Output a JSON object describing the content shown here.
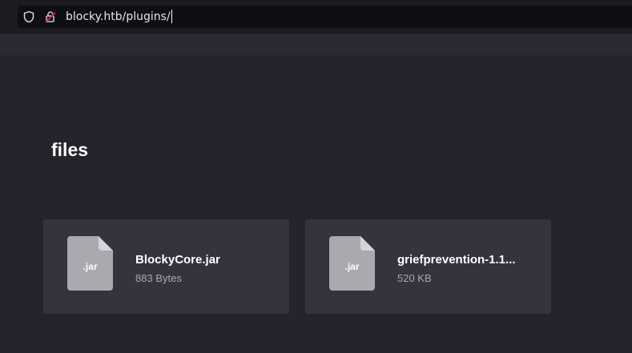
{
  "browser": {
    "url": "blocky.htb/plugins/",
    "icons": [
      "shield-icon",
      "insecure-lock-icon"
    ]
  },
  "page": {
    "heading": "files"
  },
  "files": [
    {
      "name": "BlockyCore.jar",
      "size": "883 Bytes",
      "ext": ".jar",
      "icon": "file-icon"
    },
    {
      "name": "griefprevention-1.1...",
      "size": "520 KB",
      "ext": ".jar",
      "icon": "file-icon"
    }
  ],
  "colors": {
    "background": "#25242d",
    "card": "#34333e",
    "file_icon": "#a9a9b0",
    "lock_accent": "#e22850"
  }
}
